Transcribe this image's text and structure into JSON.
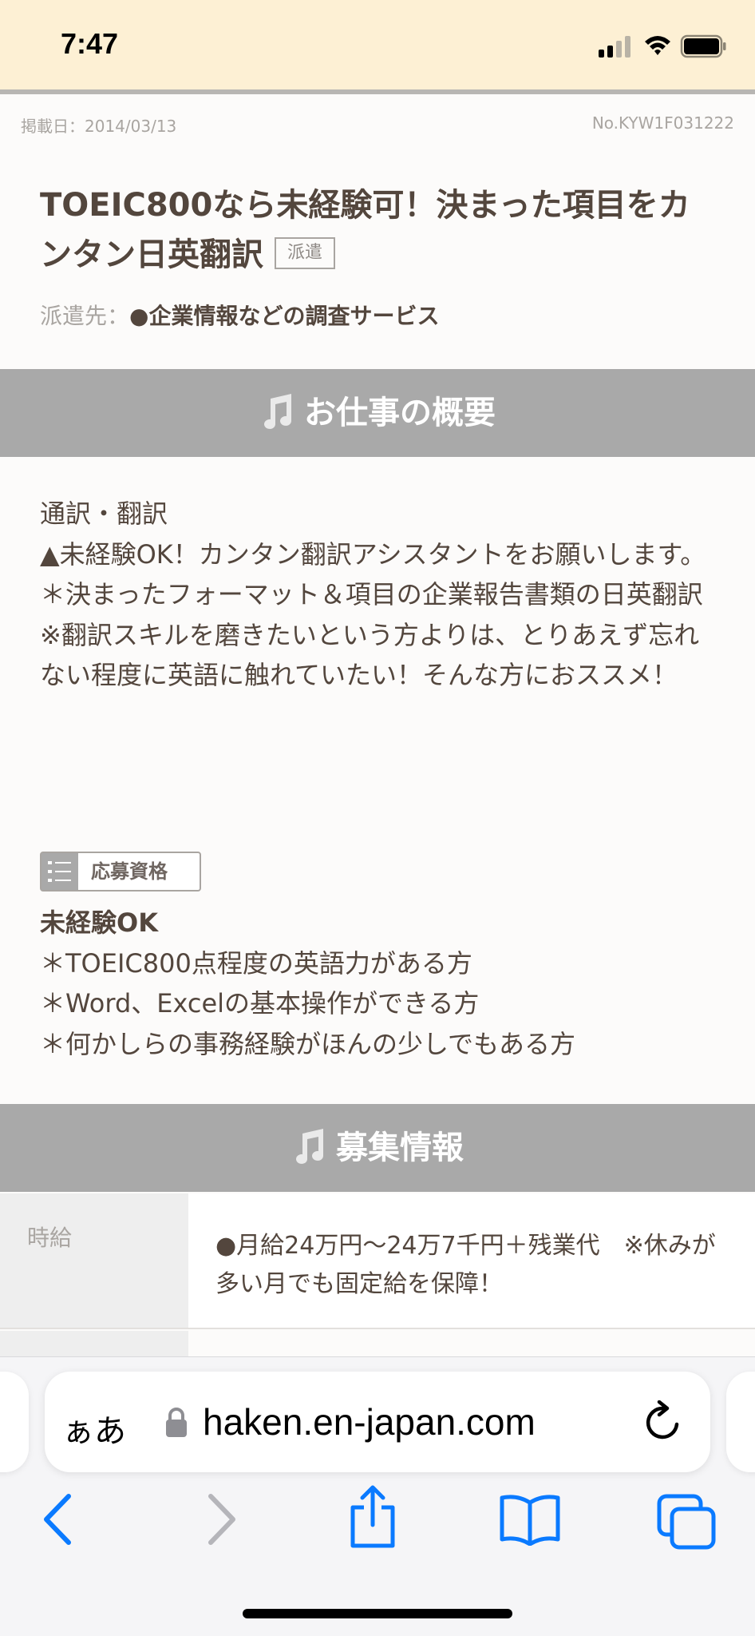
{
  "status_bar": {
    "time": "7:47"
  },
  "listing": {
    "posted_date": "掲載日：2014/03/13",
    "job_number": "No.KYW1F031222",
    "title": "TOEIC800なら未経験可！決まった項目をカンタン日英翻訳",
    "employment_tag": "派遣",
    "dispatch_label": "派遣先：",
    "dispatch_value": "●企業情報などの調査サービス"
  },
  "overview": {
    "heading": "お仕事の概要",
    "lines": [
      "通訳・翻訳",
      "▲未経験OK！カンタン翻訳アシスタントをお願いします。",
      "＊決まったフォーマット＆項目の企業報告書類の日英翻訳",
      "※翻訳スキルを磨きたいという方よりは、とりあえず忘れない程度に英語に触れていたい！そんな方におススメ！"
    ]
  },
  "requirements": {
    "badge_label": "応募資格",
    "headline": "未経験OK",
    "items": [
      "＊TOEIC800点程度の英語力がある方",
      "＊Word、Excelの基本操作ができる方",
      "＊何かしらの事務経験がほんの少しでもある方"
    ]
  },
  "recruitment": {
    "heading": "募集情報",
    "rows": [
      {
        "label": "時給",
        "value": "●月給24万円～24万7千円＋残業代　※休みが多い月でも固定給を保障！"
      }
    ]
  },
  "browser": {
    "text_size_label": "ぁあ",
    "url": "haken.en-japan.com"
  },
  "colors": {
    "status_bar_bg": "#fdf0d4",
    "section_header_bg": "#a9a9a9",
    "text_primary": "#53463d",
    "text_muted": "#a9a5a1",
    "ios_blue": "#0a7aff"
  },
  "icons": [
    "signal-icon",
    "wifi-icon",
    "battery-icon",
    "music-note-icon",
    "list-icon",
    "lock-icon",
    "reload-icon",
    "back-icon",
    "forward-icon",
    "share-icon",
    "bookmarks-icon",
    "tabs-icon"
  ]
}
